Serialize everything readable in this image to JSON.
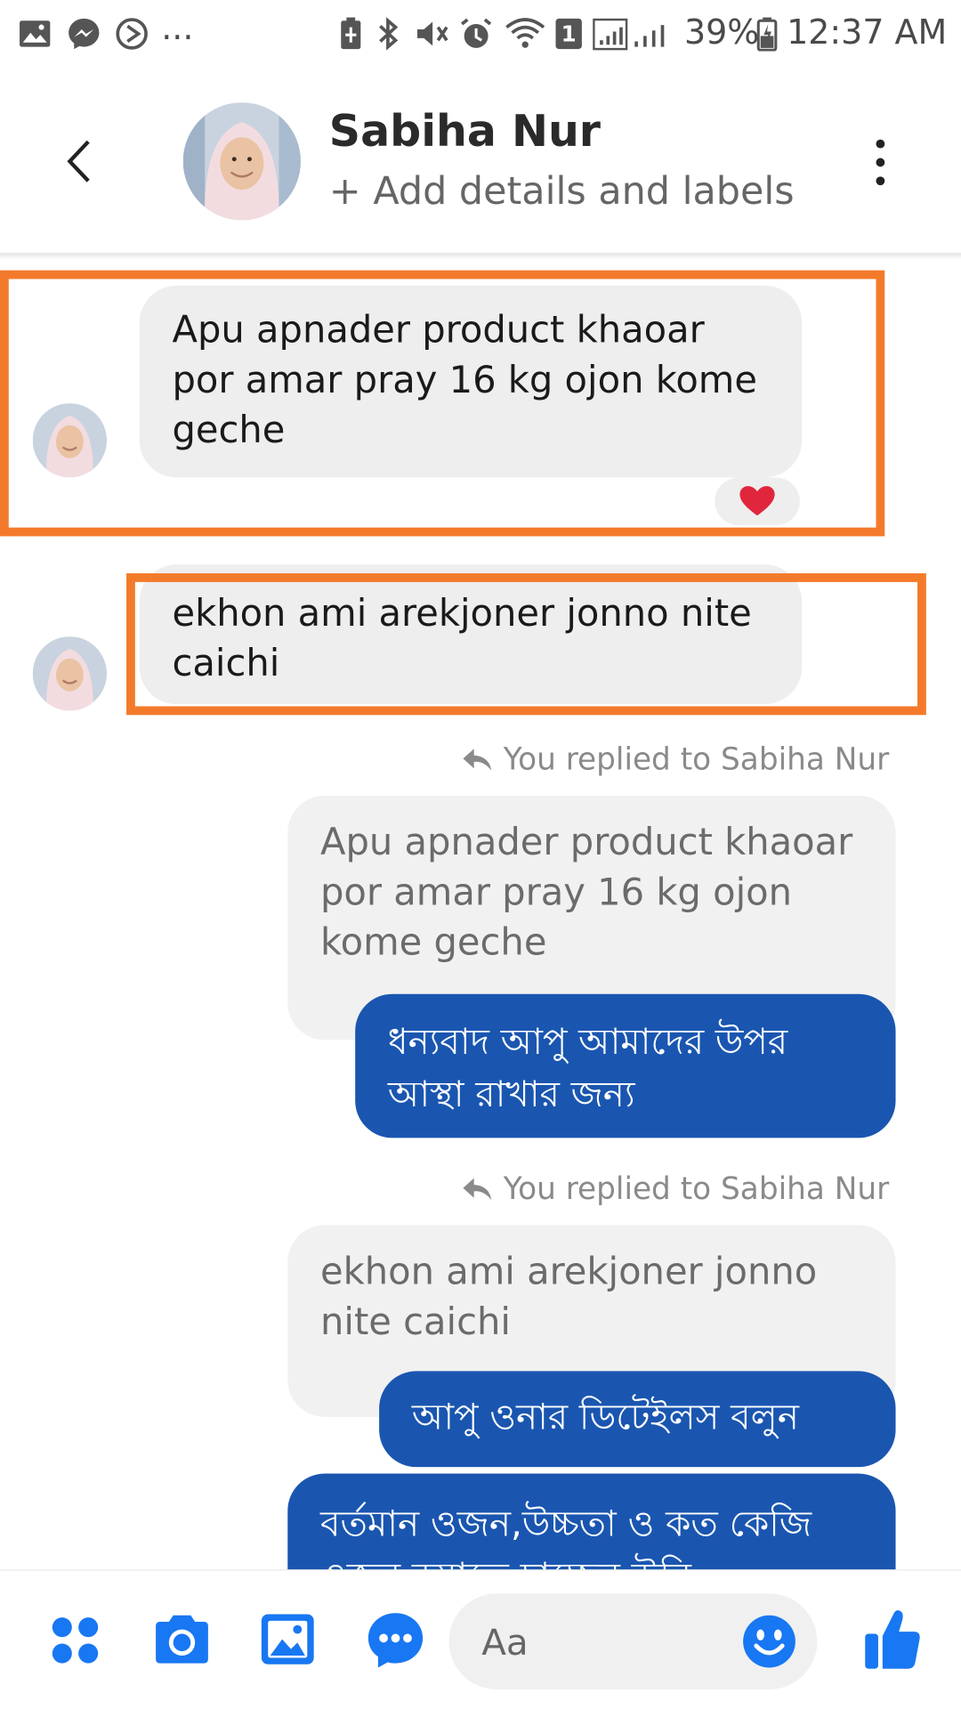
{
  "status_bar": {
    "left_icons": [
      "gallery-icon",
      "messenger-icon",
      "sync-icon"
    ],
    "overflow": "...",
    "right_icons": [
      "battery-saver-icon",
      "bluetooth-icon",
      "vibrate-icon",
      "alarm-icon",
      "wifi-icon",
      "sim-icon",
      "signal-icon"
    ],
    "sim_slot": "1",
    "battery": "39%",
    "time": "12:37 AM"
  },
  "header": {
    "contact_name": "Sabiha Nur",
    "subtitle": "+ Add details and labels",
    "back_icon": "chevron-left-icon",
    "menu_icon": "more-vertical-icon"
  },
  "conversation": {
    "incoming": [
      {
        "text": "Apu apnader product khaoar por amar pray 16 kg ojon kome geche",
        "reaction": "heart"
      },
      {
        "text": "ekhon ami arekjoner jonno nite caichi"
      }
    ],
    "replies": [
      {
        "reply_label": "You replied to Sabiha Nur",
        "quoted": "Apu apnader product khaoar por amar pray 16 kg ojon kome geche",
        "messages": [
          "ধন্যবাদ আপু আমাদের উপর আস্থা রাখার জন্য"
        ]
      },
      {
        "reply_label": "You replied to Sabiha Nur",
        "quoted": "ekhon ami arekjoner jonno nite caichi",
        "messages": [
          "আপু ওনার ডিটেইলস বলুন",
          "বর্তমান ওজন,উচ্চতা ও কত কেজি ওজন কমাতে চাচ্ছেন উনি"
        ]
      }
    ]
  },
  "composer": {
    "placeholder": "Aa",
    "icons": [
      "apps-icon",
      "camera-icon",
      "photo-icon",
      "chat-bubble-icon",
      "emoji-icon",
      "thumbs-up-icon"
    ]
  },
  "colors": {
    "accent": "#1a56b0",
    "icon_blue": "#1877f2",
    "highlight": "#f47a2b",
    "incoming_bubble": "#eeeeee"
  }
}
